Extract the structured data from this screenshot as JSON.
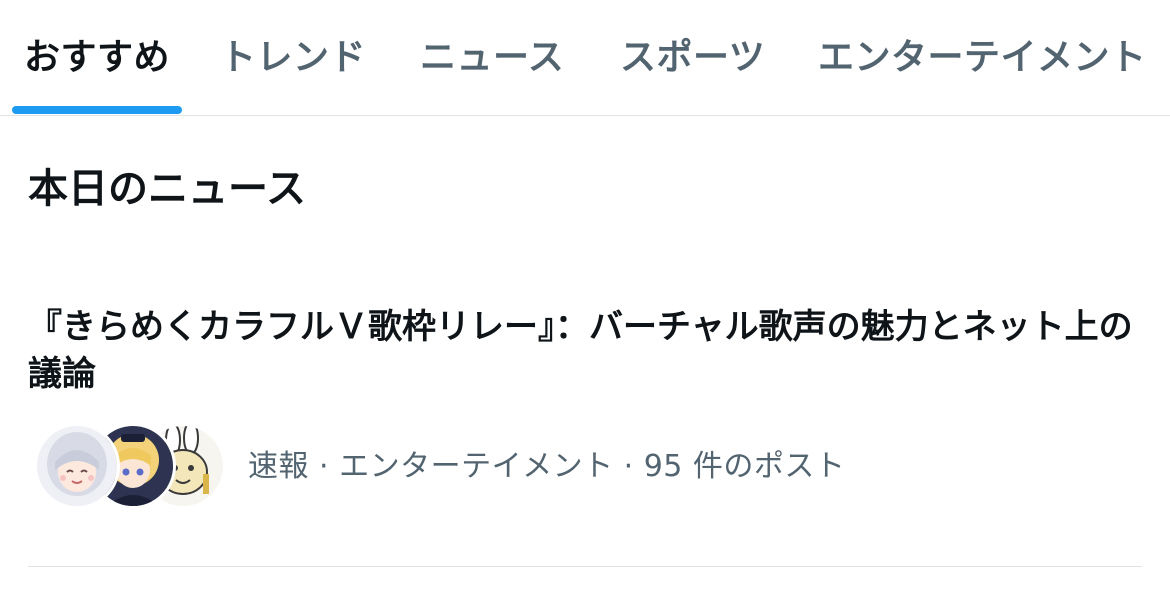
{
  "tabs": [
    {
      "label": "おすすめ",
      "active": true
    },
    {
      "label": "トレンド",
      "active": false
    },
    {
      "label": "ニュース",
      "active": false
    },
    {
      "label": "スポーツ",
      "active": false
    },
    {
      "label": "エンターテイメント",
      "active": false
    }
  ],
  "section": {
    "title": "本日のニュース"
  },
  "news_item": {
    "title": "『きらめくカラフルＶ歌枠リレー』：バーチャル歌声の魅力とネット上の議論",
    "meta": "速報 · エンターテイメント · 95 件のポスト",
    "avatars": [
      "silver-haired-girl-avatar",
      "blonde-girl-avatar",
      "cartoon-bunny-avatar"
    ]
  },
  "colors": {
    "accent": "#1d9bf0",
    "text_primary": "#0f1419",
    "text_secondary": "#536471",
    "divider": "#dfe3e6"
  }
}
